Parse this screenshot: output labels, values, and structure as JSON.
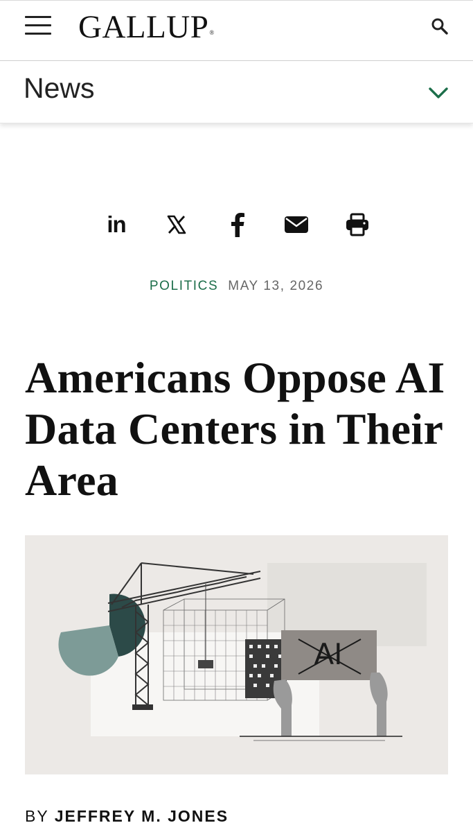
{
  "header": {
    "logo_text": "GALLUP",
    "logo_mark": "®",
    "menu_icon": "hamburger-icon",
    "search_icon": "search-icon"
  },
  "section_nav": {
    "label": "News",
    "toggle_icon": "chevron-down-icon",
    "accent_color": "#1c6e4a"
  },
  "share": {
    "icons": [
      "linkedin-icon",
      "x-icon",
      "facebook-icon",
      "email-icon",
      "print-icon"
    ],
    "linkedin_text": "in"
  },
  "article": {
    "category": "POLITICS",
    "date": "MAY 13, 2026",
    "title": "Americans Oppose AI Data Centers in Their Area",
    "byline_prefix": "BY",
    "author": "JEFFREY M. JONES"
  },
  "hero_image": {
    "sign_text": "AI",
    "background_color": "#ece9e6"
  }
}
